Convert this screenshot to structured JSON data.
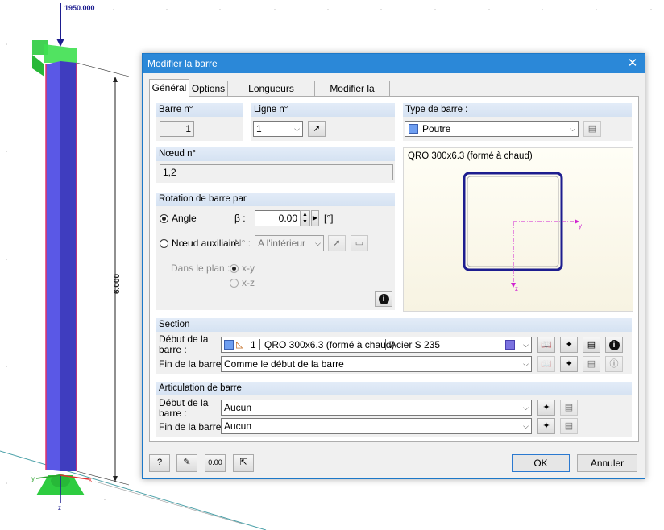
{
  "model": {
    "load_value": "1950.000",
    "dimension": "6.000",
    "axis_x": "x",
    "axis_y": "y",
    "axis_z": "z"
  },
  "dialog": {
    "title": "Modifier la barre",
    "close_icon": "close-icon",
    "tabs": [
      "Général",
      "Options",
      "Longueurs efficaces",
      "Modifier la rigidité"
    ],
    "barre": {
      "label": "Barre n°",
      "value": "1"
    },
    "ligne": {
      "label": "Ligne n°",
      "value": "1"
    },
    "type": {
      "label": "Type de barre :",
      "value": "Poutre",
      "color": "#6e9ef0"
    },
    "noeud": {
      "label": "Nœud n°",
      "value": "1,2"
    },
    "rotation": {
      "title": "Rotation de barre par",
      "angle_label": "Angle",
      "beta_label": "β :",
      "beta_value": "0.00",
      "unit": "[°]",
      "aux_label": "Nœud auxiliaire",
      "no_label": "N° :",
      "no_value": "A l'intérieur",
      "plan_label": "Dans le plan :",
      "xy": "x-y",
      "xz": "x-z",
      "selected": "Angle"
    },
    "preview": {
      "caption": "QRO 300x6.3 (formé à chaud)",
      "y_label": "y",
      "z_label": "z"
    },
    "section": {
      "title": "Section",
      "debut_label": "Début de la barre :",
      "debut_no": "1",
      "debut_name": "QRO 300x6.3 (formé à chaud)",
      "debut_material": "Acier S 235",
      "material_color": "#7b72e0",
      "fin_label": "Fin de la barre :",
      "fin_value": "Comme le début de la barre"
    },
    "articulation": {
      "title": "Articulation de barre",
      "debut_label": "Début de la barre :",
      "debut_value": "Aucun",
      "fin_label": "Fin de la barre :",
      "fin_value": "Aucun"
    },
    "footer": {
      "ok": "OK",
      "cancel": "Annuler"
    }
  }
}
